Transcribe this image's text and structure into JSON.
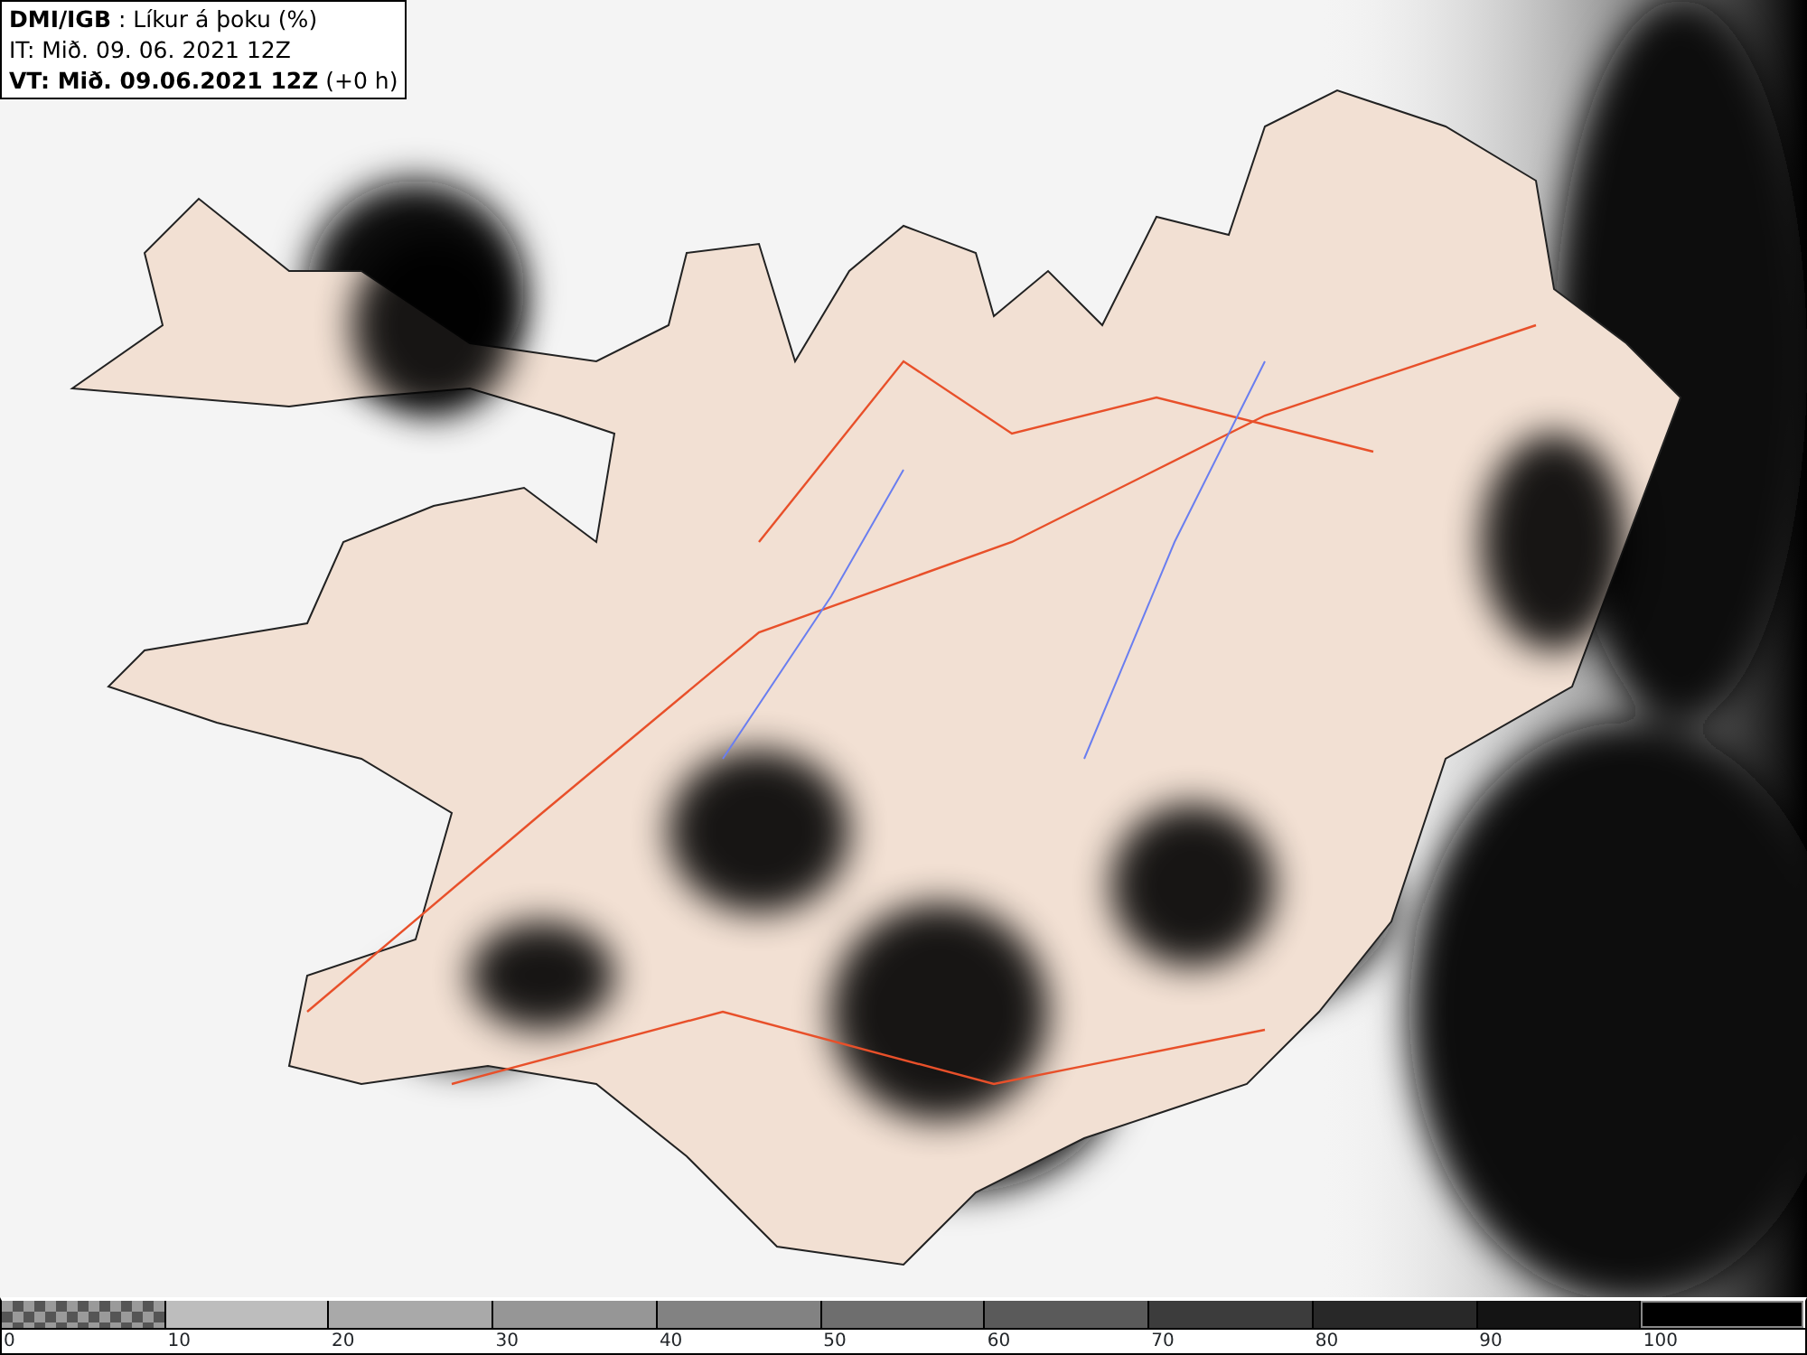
{
  "info_box": {
    "lines": [
      "**DMI/IGB** : Líkur á þoku (%)",
      "IT: Mið. 09. 06. 2021 12Z",
      "**VT: Mið. 09.06.2021 12Z** (+0 h)"
    ]
  },
  "legend": {
    "segments": [
      {
        "kind": "checker",
        "color": "#9a9a9a"
      },
      {
        "kind": "solid",
        "color": "#bdbdbd"
      },
      {
        "kind": "solid",
        "color": "#a9a9a9"
      },
      {
        "kind": "solid",
        "color": "#969696"
      },
      {
        "kind": "solid",
        "color": "#828282"
      },
      {
        "kind": "solid",
        "color": "#6e6e6e"
      },
      {
        "kind": "solid",
        "color": "#5a5a5a"
      },
      {
        "kind": "solid",
        "color": "#3c3c3c"
      },
      {
        "kind": "solid",
        "color": "#282828"
      },
      {
        "kind": "solid",
        "color": "#141414"
      },
      {
        "kind": "solid",
        "color": "#000000"
      }
    ],
    "labels": [
      "0",
      "10",
      "20",
      "30",
      "40",
      "50",
      "60",
      "70",
      "80",
      "90",
      "100"
    ]
  }
}
